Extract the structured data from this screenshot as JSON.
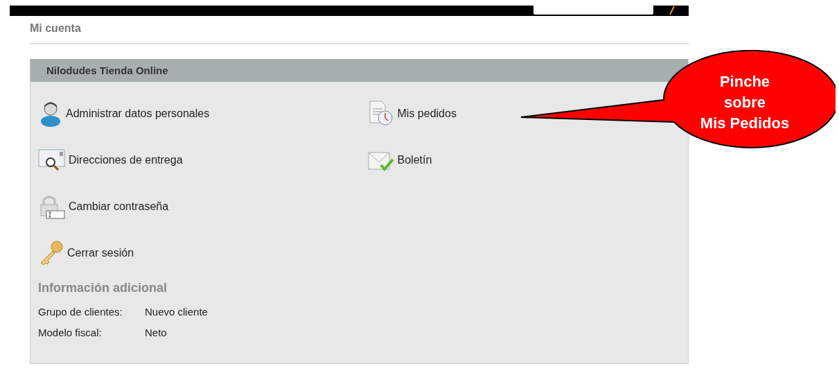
{
  "page_title": "Mi cuenta",
  "panel": {
    "title": "Nilodudes Tienda Online",
    "left_links": [
      {
        "label": "Administrar datos personales"
      },
      {
        "label": "Direcciones de entrega"
      },
      {
        "label": "Cambiar contraseña"
      },
      {
        "label": "Cerrar sesión"
      }
    ],
    "right_links": [
      {
        "label": "Mis pedidos"
      },
      {
        "label": "Boletín"
      }
    ],
    "additional_info": {
      "heading": "Información adicional",
      "rows": [
        {
          "label": "Grupo de clientes:",
          "value": "Nuevo cliente"
        },
        {
          "label": "Modelo fiscal:",
          "value": "Neto"
        }
      ]
    }
  },
  "callout": {
    "lines": [
      "Pinche",
      "sobre",
      "Mis Pedidos"
    ]
  }
}
